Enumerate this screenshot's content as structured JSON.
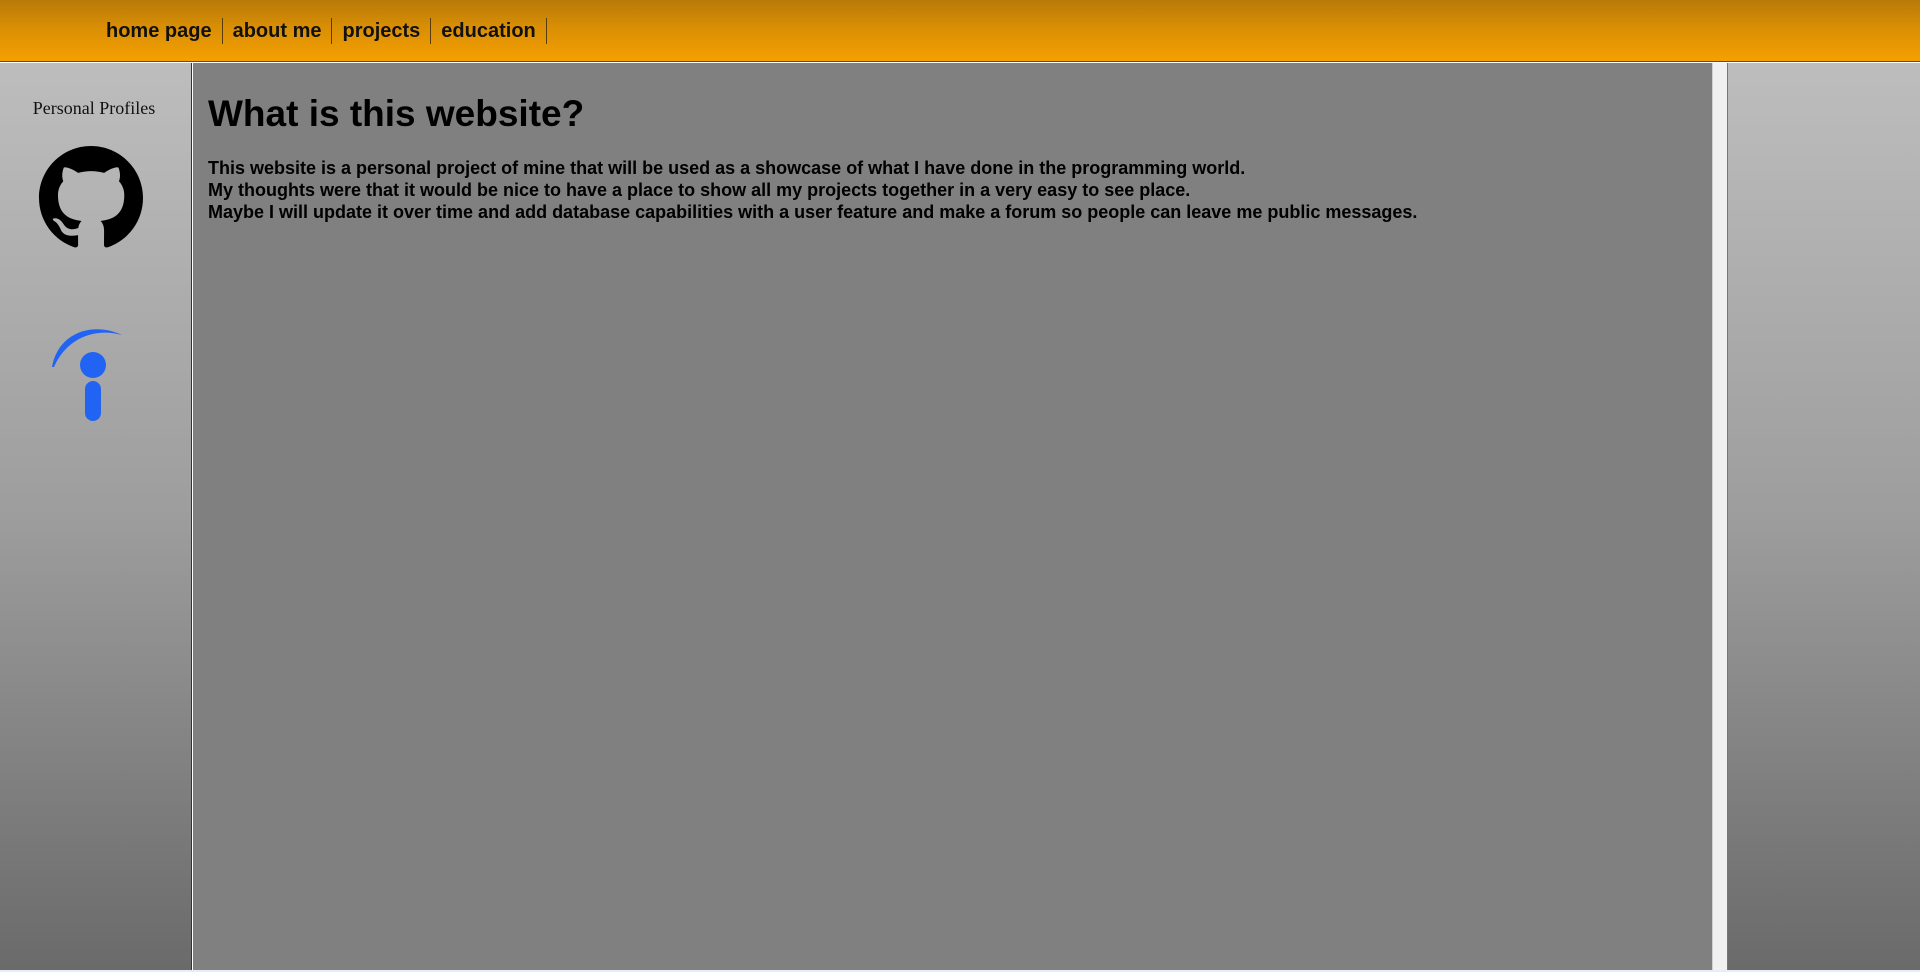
{
  "nav": {
    "items": [
      {
        "label": "home page"
      },
      {
        "label": "about me"
      },
      {
        "label": "projects"
      },
      {
        "label": "education"
      }
    ]
  },
  "sidebar": {
    "title": "Personal Profiles",
    "profiles": [
      {
        "icon": "github-icon",
        "color": "#000000"
      },
      {
        "icon": "indeed-icon",
        "color": "#2164f3"
      }
    ]
  },
  "main": {
    "heading": "What is this website?",
    "paragraphs": [
      "This website is a personal project of mine that will be used as a showcase of what I have done in the programming world.",
      "My thoughts were that it would be nice to have a place to show all my projects together in a very easy to see place.",
      "Maybe I will update it over time and add database capabilities with a user feature and make a forum so people can leave me public messages."
    ]
  },
  "colors": {
    "header_top": "#b97a08",
    "header_bottom": "#f5a000",
    "content_bg": "#808080",
    "sidebar_top": "#bdbdbd",
    "sidebar_bottom": "#6a6a6a"
  }
}
